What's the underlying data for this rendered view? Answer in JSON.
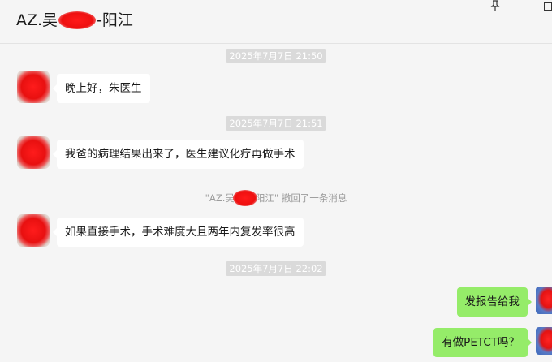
{
  "header": {
    "title_prefix": "AZ.吴",
    "title_suffix": "-阳江",
    "pin_icon": "pin-icon",
    "maximize_icon": "maximize-icon"
  },
  "messages": [
    {
      "type": "timestamp",
      "text": "2025年7月7日 21:50"
    },
    {
      "type": "incoming",
      "text": "晚上好，朱医生"
    },
    {
      "type": "timestamp",
      "text": "2025年7月7日 21:51"
    },
    {
      "type": "incoming",
      "text": "我爸的病理结果出来了，医生建议化疗再做手术"
    },
    {
      "type": "system",
      "prefix": "\"AZ.吴",
      "suffix": "阳江\" 撤回了一条消息"
    },
    {
      "type": "incoming",
      "text": "如果直接手术，手术难度大且两年内复发率很高"
    },
    {
      "type": "timestamp",
      "text": "2025年7月7日 22:02"
    },
    {
      "type": "outgoing",
      "text": "发报告给我"
    },
    {
      "type": "outgoing",
      "text": "有做PETCT吗？"
    }
  ],
  "colors": {
    "background": "#f5f5f5",
    "incoming_bubble": "#ffffff",
    "outgoing_bubble": "#95ec69",
    "timestamp_bg": "#dadada",
    "redaction": "#ee1010"
  }
}
